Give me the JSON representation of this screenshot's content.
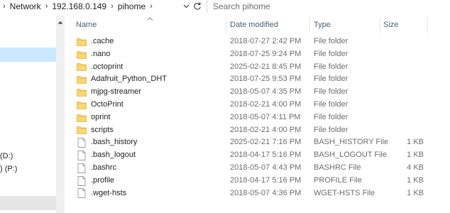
{
  "address": {
    "crumbs": [
      "Network",
      "192.168.0.149",
      "pihome"
    ],
    "separator": "›"
  },
  "search": {
    "placeholder": "Search pihome"
  },
  "nav": {
    "items": [
      {
        "label": "(D:)"
      },
      {
        "label": ") (P:)"
      }
    ]
  },
  "columns": {
    "name": "Name",
    "date": "Date modified",
    "type": "Type",
    "size": "Size"
  },
  "files": [
    {
      "name": ".cache",
      "date": "2018-07-27 2:42 PM",
      "type": "File folder",
      "size": "",
      "kind": "folder"
    },
    {
      "name": ".nano",
      "date": "2018-07-25 9:24 PM",
      "type": "File folder",
      "size": "",
      "kind": "folder"
    },
    {
      "name": ".octoprint",
      "date": "2025-02-21 8:45 PM",
      "type": "File folder",
      "size": "",
      "kind": "folder"
    },
    {
      "name": "Adafruit_Python_DHT",
      "date": "2018-07-25 9:53 PM",
      "type": "File folder",
      "size": "",
      "kind": "folder"
    },
    {
      "name": "mjpg-streamer",
      "date": "2018-05-07 4:35 PM",
      "type": "File folder",
      "size": "",
      "kind": "folder"
    },
    {
      "name": "OctoPrint",
      "date": "2018-02-21 4:00 PM",
      "type": "File folder",
      "size": "",
      "kind": "folder"
    },
    {
      "name": "oprint",
      "date": "2018-05-07 4:11 PM",
      "type": "File folder",
      "size": "",
      "kind": "folder"
    },
    {
      "name": "scripts",
      "date": "2018-02-21 4:00 PM",
      "type": "File folder",
      "size": "",
      "kind": "folder"
    },
    {
      "name": ".bash_history",
      "date": "2025-02-21 7:16 PM",
      "type": "BASH_HISTORY File",
      "size": "1 KB",
      "kind": "file"
    },
    {
      "name": ".bash_logout",
      "date": "2018-04-17 5:16 PM",
      "type": "BASH_LOGOUT File",
      "size": "1 KB",
      "kind": "file"
    },
    {
      "name": ".bashrc",
      "date": "2018-05-07 4:43 PM",
      "type": "BASHRC File",
      "size": "4 KB",
      "kind": "file"
    },
    {
      "name": ".profile",
      "date": "2018-04-17 5:16 PM",
      "type": "PROFILE File",
      "size": "1 KB",
      "kind": "file"
    },
    {
      "name": ".wget-hsts",
      "date": "2018-05-07 4:36 PM",
      "type": "WGET-HSTS File",
      "size": "1 KB",
      "kind": "file"
    }
  ],
  "colors": {
    "folder": "#f8d775",
    "folder_dark": "#e3b341",
    "header_text": "#4c607a",
    "nav_selected": "#cce8ff"
  }
}
